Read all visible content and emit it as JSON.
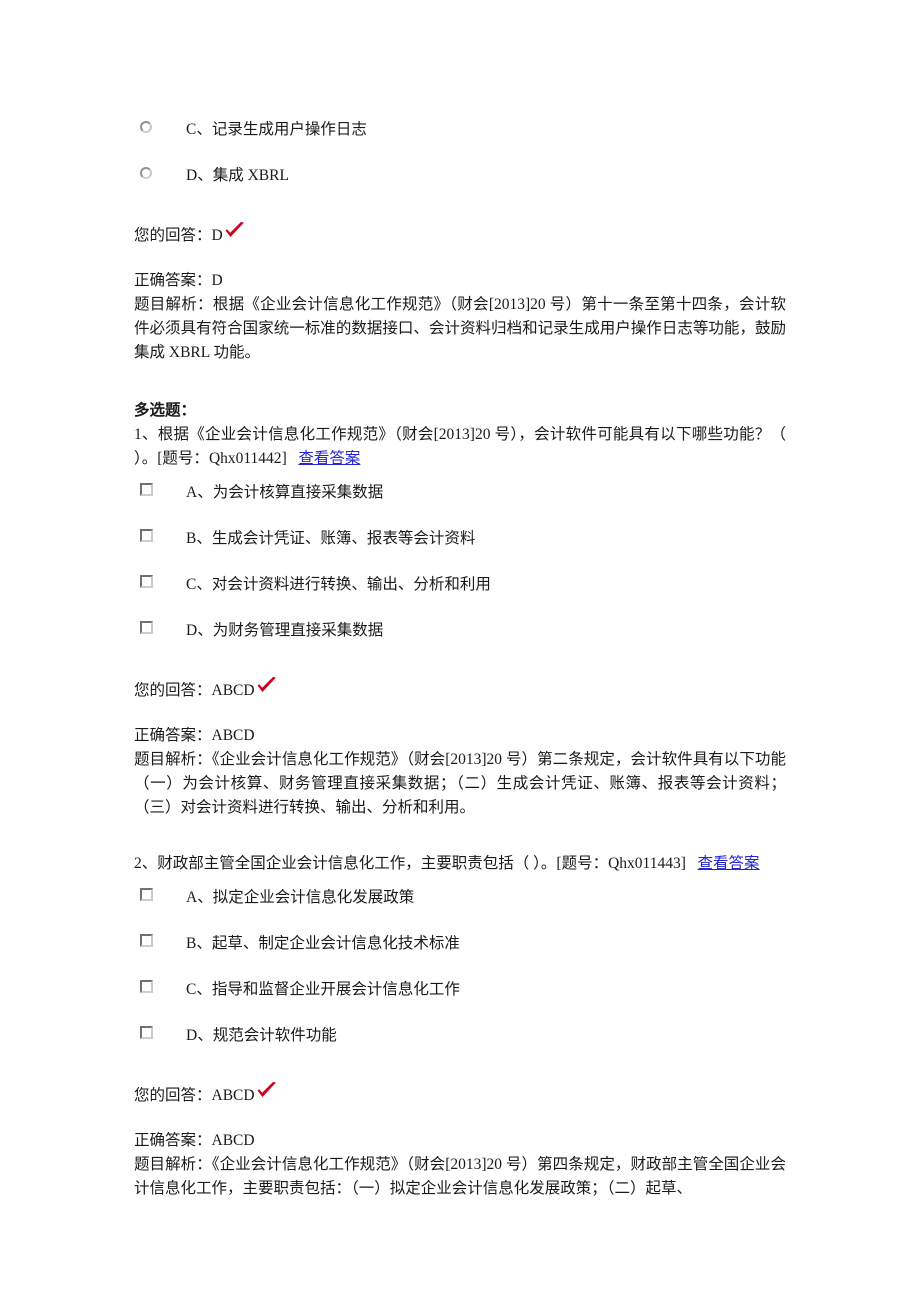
{
  "document": {
    "single_choice_tail": {
      "options": [
        {
          "id": "C",
          "label": "C、记录生成用户操作日志",
          "control": "radio",
          "selected": false
        },
        {
          "id": "D",
          "label": "D、集成 XBRL",
          "control": "radio",
          "selected": false
        }
      ],
      "your_answer_label": "您的回答：",
      "your_answer_value": "D",
      "correct_answer_label": "正确答案：",
      "correct_answer_value": "D",
      "explanation_label": "题目解析：",
      "explanation_text": "根据《企业会计信息化工作规范》（财会[2013]20 号）第十一条至第十四条，会计软件必须具有符合国家统一标准的数据接口、会计资料归档和记录生成用户操作日志等功能，鼓励集成 XBRL 功能。"
    },
    "section": {
      "title": "多选题："
    },
    "questions": [
      {
        "number": "1、",
        "stem": "根据《企业会计信息化工作规范》（财会[2013]20 号），会计软件可能具有以下哪些功能？（ ）。",
        "qid_prefix": "[题号：",
        "qid": "Qhx011442",
        "qid_suffix": "]",
        "view_answer_link": "查看答案",
        "options": [
          {
            "id": "A",
            "label": "A、为会计核算直接采集数据",
            "control": "checkbox",
            "checked": false
          },
          {
            "id": "B",
            "label": "B、生成会计凭证、账簿、报表等会计资料",
            "control": "checkbox",
            "checked": false
          },
          {
            "id": "C",
            "label": "C、对会计资料进行转换、输出、分析和利用",
            "control": "checkbox",
            "checked": false
          },
          {
            "id": "D",
            "label": "D、为财务管理直接采集数据",
            "control": "checkbox",
            "checked": false
          }
        ],
        "your_answer_label": "您的回答：",
        "your_answer_value": "ABCD",
        "answer_correct": true,
        "correct_answer_label": "正确答案：",
        "correct_answer_value": "ABCD",
        "explanation_label": "题目解析：",
        "explanation_text": "《企业会计信息化工作规范》（财会[2013]20 号）第二条规定，会计软件具有以下功能（一）为会计核算、财务管理直接采集数据；（二）生成会计凭证、账簿、报表等会计资料；（三）对会计资料进行转换、输出、分析和利用。"
      },
      {
        "number": "2、",
        "stem": "财政部主管全国企业会计信息化工作，主要职责包括（ ）。",
        "qid_prefix": "[题号：",
        "qid": "Qhx011443",
        "qid_suffix": "]",
        "view_answer_link": "查看答案",
        "options": [
          {
            "id": "A",
            "label": "A、拟定企业会计信息化发展政策",
            "control": "checkbox",
            "checked": false
          },
          {
            "id": "B",
            "label": "B、起草、制定企业会计信息化技术标准",
            "control": "checkbox",
            "checked": false
          },
          {
            "id": "C",
            "label": "C、指导和监督企业开展会计信息化工作",
            "control": "checkbox",
            "checked": false
          },
          {
            "id": "D",
            "label": "D、规范会计软件功能",
            "control": "checkbox",
            "checked": false
          }
        ],
        "your_answer_label": "您的回答：",
        "your_answer_value": "ABCD",
        "answer_correct": true,
        "correct_answer_label": "正确答案：",
        "correct_answer_value": "ABCD",
        "explanation_label": "题目解析：",
        "explanation_text": "《企业会计信息化工作规范》（财会[2013]20 号）第四条规定，财政部主管全国企业会计信息化工作，主要职责包括：（一）拟定企业会计信息化发展政策；（二）起草、"
      }
    ],
    "colors": {
      "link": "#2626cc",
      "check_mark": "#d0021b",
      "text": "#1a1a1a"
    }
  }
}
